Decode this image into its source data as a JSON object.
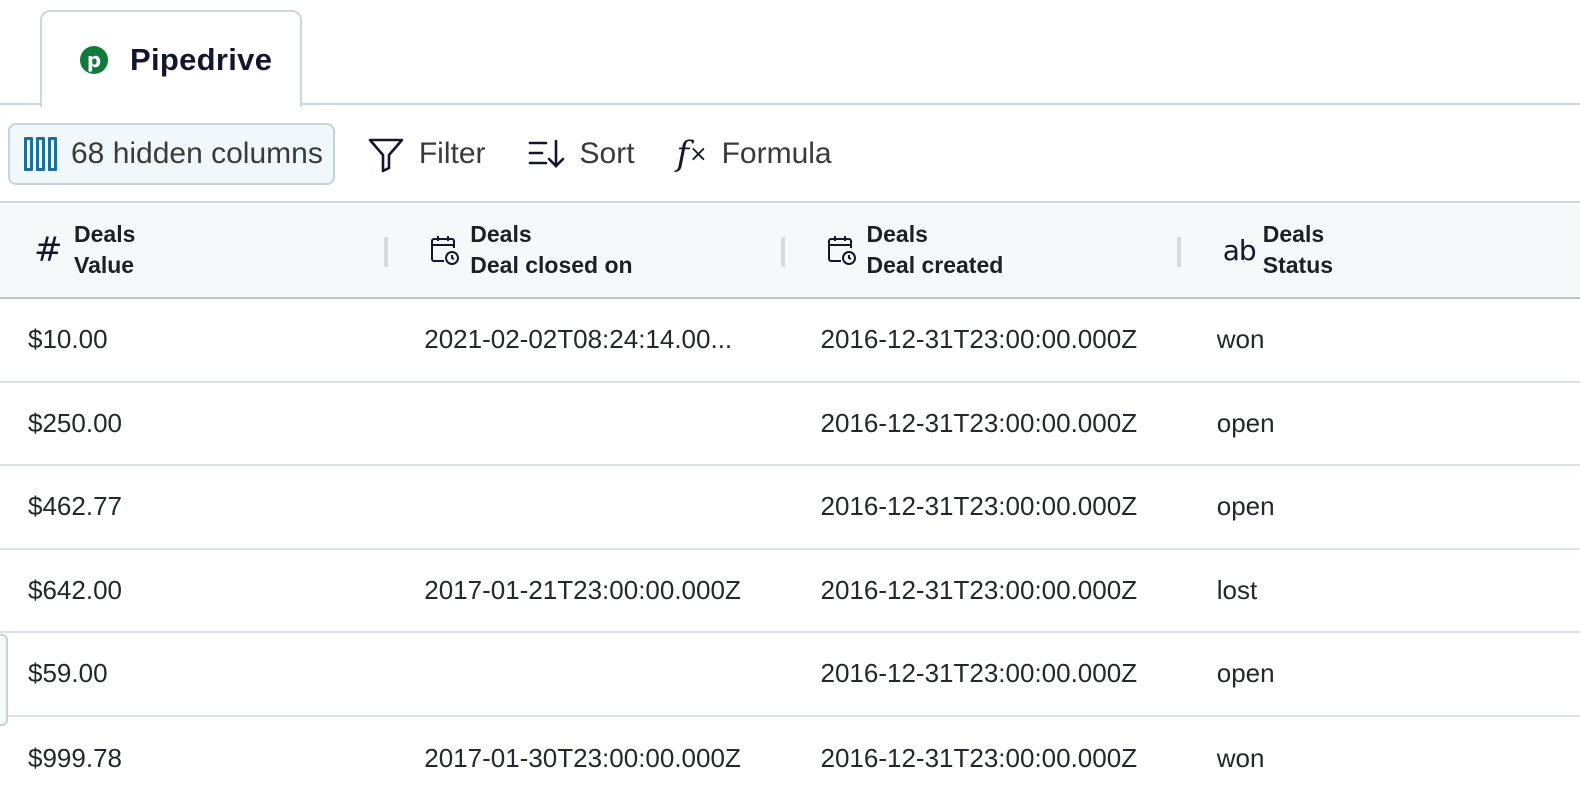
{
  "tab": {
    "label": "Pipedrive",
    "logo_letter": "p",
    "logo_color": "#0f7a3a"
  },
  "toolbar": {
    "hidden_columns_label": "68 hidden columns",
    "filter_label": "Filter",
    "sort_label": "Sort",
    "formula_label": "Formula",
    "formula_icon_f": "f",
    "formula_icon_x": "×",
    "sort_icon": "☰↓"
  },
  "table": {
    "columns": [
      {
        "type_icon": "#",
        "type": "number",
        "group": "Deals",
        "name": "Value"
      },
      {
        "type_icon": "calendar-clock",
        "type": "datetime",
        "group": "Deals",
        "name": "Deal closed on"
      },
      {
        "type_icon": "calendar-clock",
        "type": "datetime",
        "group": "Deals",
        "name": "Deal created"
      },
      {
        "type_icon": "ab",
        "type": "text",
        "group": "Deals",
        "name": "Status"
      }
    ],
    "rows": [
      [
        "$10.00",
        "2021-02-02T08:24:14.00...",
        "2016-12-31T23:00:00.000Z",
        "won"
      ],
      [
        "$250.00",
        "",
        "2016-12-31T23:00:00.000Z",
        "open"
      ],
      [
        "$462.77",
        "",
        "2016-12-31T23:00:00.000Z",
        "open"
      ],
      [
        "$642.00",
        "2017-01-21T23:00:00.000Z",
        "2016-12-31T23:00:00.000Z",
        "lost"
      ],
      [
        "$59.00",
        "",
        "2016-12-31T23:00:00.000Z",
        "open"
      ],
      [
        "$999.78",
        "2017-01-30T23:00:00.000Z",
        "2016-12-31T23:00:00.000Z",
        "won"
      ]
    ]
  }
}
